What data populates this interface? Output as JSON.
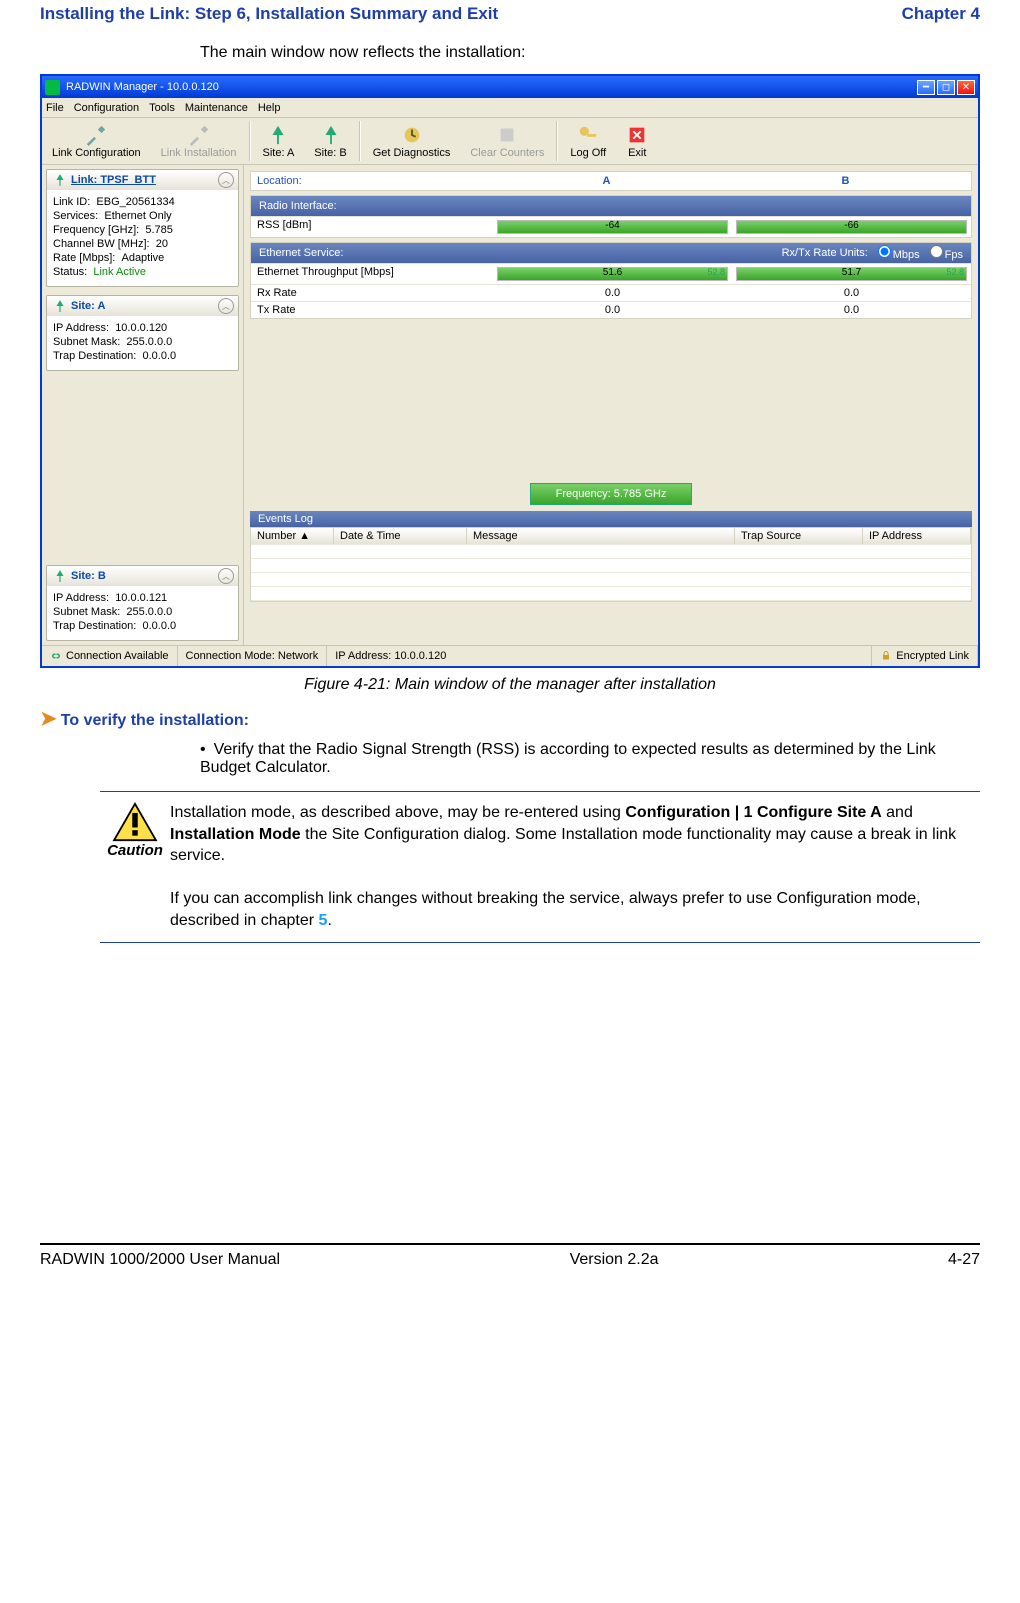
{
  "doc": {
    "header_left": "Installing the Link: Step 6, Installation Summary and Exit",
    "header_right": "Chapter 4",
    "intro": "The main window now reflects the installation:",
    "figcap": "Figure 4-21: Main window of the manager after installation",
    "proc": "To verify the installation:",
    "bullet": "Verify that the Radio Signal Strength (RSS) is according to expected results as determined by the Link Budget Calculator.",
    "caution_label": "Caution",
    "caution_p1a": "Installation mode, as described above, may be re-entered using ",
    "caution_b1": "Configuration | 1 Configure Site A",
    "caution_mid": " and ",
    "caution_b2": "Installation Mode",
    "caution_p1b": " the Site Configuration dialog. Some Installation mode functionality may cause a break in link service.",
    "caution_p2a": "If you can accomplish link changes without breaking the service, always prefer to use Configuration mode, described in chapter ",
    "caution_chref": "5",
    "caution_p2b": ".",
    "foot_left": "RADWIN 1000/2000 User Manual",
    "foot_mid": "Version  2.2a",
    "foot_right": "4-27"
  },
  "app": {
    "title": "RADWIN Manager - 10.0.0.120",
    "menu": [
      "File",
      "Configuration",
      "Tools",
      "Maintenance",
      "Help"
    ],
    "toolbar": {
      "link_config": "Link Configuration",
      "link_install": "Link Installation",
      "site_a": "Site: A",
      "site_b": "Site: B",
      "diag": "Get Diagnostics",
      "clear": "Clear Counters",
      "logoff": "Log Off",
      "exit": "Exit"
    },
    "link_panel": {
      "title": "Link: TPSF_BTT",
      "id_lbl": "Link ID:",
      "id_val": "EBG_20561334",
      "svc_lbl": "Services:",
      "svc_val": "Ethernet Only",
      "freq_lbl": "Frequency [GHz]:",
      "freq_val": "5.785",
      "bw_lbl": "Channel BW [MHz]:",
      "bw_val": "20",
      "rate_lbl": "Rate [Mbps]:",
      "rate_val": "Adaptive",
      "stat_lbl": "Status:",
      "stat_val": "Link Active"
    },
    "sitea": {
      "title": "Site: A",
      "ip_lbl": "IP Address:",
      "ip_val": "10.0.0.120",
      "sm_lbl": "Subnet Mask:",
      "sm_val": "255.0.0.0",
      "td_lbl": "Trap Destination:",
      "td_val": "0.0.0.0"
    },
    "siteb": {
      "title": "Site: B",
      "ip_lbl": "IP Address:",
      "ip_val": "10.0.0.121",
      "sm_lbl": "Subnet Mask:",
      "sm_val": "255.0.0.0",
      "td_lbl": "Trap Destination:",
      "td_val": "0.0.0.0"
    },
    "location": {
      "label": "Location:",
      "a": "A",
      "b": "B"
    },
    "radio": {
      "head": "Radio Interface:",
      "rss_lbl": "RSS [dBm]",
      "rss_a": "-64",
      "rss_b": "-66"
    },
    "eth": {
      "head": "Ethernet Service:",
      "rxunits": "Rx/Tx Rate Units:",
      "mbps": "Mbps",
      "fps": "Fps",
      "thr_lbl": "Ethernet Throughput [Mbps]",
      "thr_a": "51.6",
      "thr_b": "51.7",
      "cap": "52.8",
      "rx_lbl": "Rx Rate",
      "rx_a": "0.0",
      "rx_b": "0.0",
      "tx_lbl": "Tx Rate",
      "tx_a": "0.0",
      "tx_b": "0.0"
    },
    "freq_box": "Frequency: 5.785 GHz",
    "events": {
      "head": "Events Log",
      "cols": {
        "num": "Number",
        "dt": "Date & Time",
        "msg": "Message",
        "src": "Trap Source",
        "ip": "IP Address"
      }
    },
    "status": {
      "conn": "Connection Available",
      "mode": "Connection Mode: Network",
      "ip": "IP Address: 10.0.0.120",
      "enc": "Encrypted Link"
    }
  }
}
